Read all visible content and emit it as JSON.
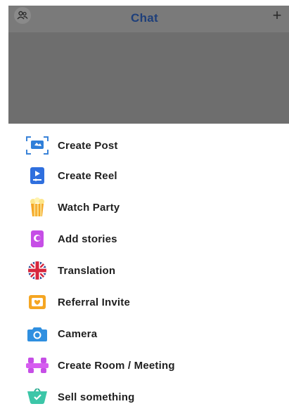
{
  "header": {
    "title": "Chat",
    "left_icon": "people-icon",
    "right_icon": "plus-icon",
    "plus_glyph": "+"
  },
  "menu": {
    "items": [
      {
        "label": "Create Post",
        "icon": "create-post-icon"
      },
      {
        "label": "Create Reel",
        "icon": "create-reel-icon"
      },
      {
        "label": "Watch Party",
        "icon": "popcorn-icon"
      },
      {
        "label": "Add stories",
        "icon": "add-stories-icon"
      },
      {
        "label": "Translation",
        "icon": "uk-flag-icon"
      },
      {
        "label": "Referral Invite",
        "icon": "referral-invite-icon"
      },
      {
        "label": "Camera",
        "icon": "camera-icon"
      },
      {
        "label": "Create Room / Meeting",
        "icon": "meeting-room-icon"
      },
      {
        "label": "Sell something",
        "icon": "sell-icon"
      }
    ]
  },
  "colors": {
    "title": "#1e3f7a",
    "overlay": "#6e6e6e",
    "text": "#1f1f1f"
  }
}
